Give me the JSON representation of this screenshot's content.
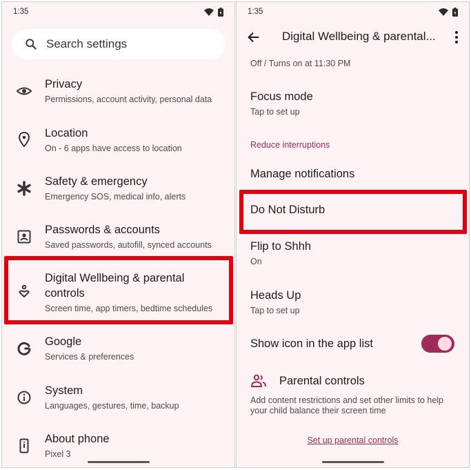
{
  "status": {
    "time": "1:35"
  },
  "left": {
    "search": {
      "placeholder": "Search settings",
      "icon": "search-icon"
    },
    "items": [
      {
        "title": "Privacy",
        "subtitle": "Permissions, account activity, personal data",
        "icon": "eye-icon"
      },
      {
        "title": "Location",
        "subtitle": "On - 6 apps have access to location",
        "icon": "location-pin-icon"
      },
      {
        "title": "Safety & emergency",
        "subtitle": "Emergency SOS, medical info, alerts",
        "icon": "asterisk-icon"
      },
      {
        "title": "Passwords & accounts",
        "subtitle": "Saved passwords, autofill, synced accounts",
        "icon": "account-box-icon"
      },
      {
        "title_line1": "Digital Wellbeing & parental",
        "title_line2": "controls",
        "subtitle": "Screen time, app timers, bedtime schedules",
        "icon": "wellbeing-icon"
      },
      {
        "title": "Google",
        "subtitle": "Services & preferences",
        "icon": "google-icon"
      },
      {
        "title": "System",
        "subtitle": "Languages, gestures, time, backup",
        "icon": "info-icon"
      },
      {
        "title": "About phone",
        "subtitle": "Pixel 3",
        "icon": "phone-icon"
      }
    ]
  },
  "right": {
    "header": {
      "title": "Digital Wellbeing & parental...",
      "back_icon": "back-arrow-icon",
      "more_icon": "more-vert-icon"
    },
    "bedtime": {
      "subtitle": "Off / Turns on at 11:30 PM"
    },
    "focus": {
      "title": "Focus mode",
      "subtitle": "Tap to set up"
    },
    "section_label": "Reduce interruptions",
    "manage_notifications": "Manage notifications",
    "dnd": "Do Not Disturb",
    "flip": {
      "title": "Flip to Shhh",
      "subtitle": "On"
    },
    "heads_up": {
      "title": "Heads Up",
      "subtitle": "Tap to set up"
    },
    "show_icon": {
      "title": "Show icon in the app list",
      "toggle_on": true
    },
    "parental": {
      "title": "Parental controls",
      "icon": "parental-people-icon",
      "description_line1": "Add content restrictions and set other limits to help",
      "description_line2": "your child balance their screen time",
      "link": "Set up parental controls"
    }
  },
  "colors": {
    "background": "#fdf3f4",
    "accent": "#9e2b58",
    "highlight": "#e1000f"
  }
}
